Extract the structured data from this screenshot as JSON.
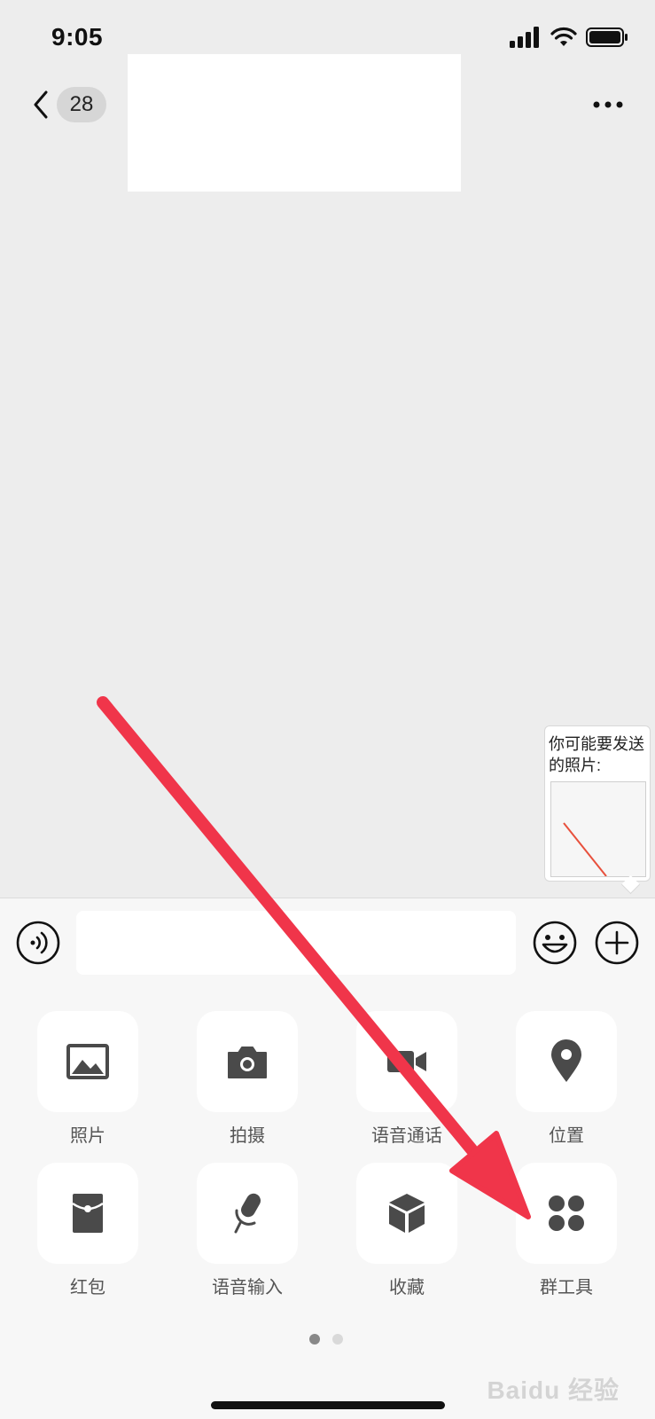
{
  "status_bar": {
    "time": "9:05"
  },
  "nav": {
    "unread_count": "28"
  },
  "suggestion": {
    "text": "你可能要发送的照片:"
  },
  "input": {
    "value": ""
  },
  "tools": [
    {
      "label": "照片",
      "icon": "image-icon"
    },
    {
      "label": "拍摄",
      "icon": "camera-icon"
    },
    {
      "label": "语音通话",
      "icon": "video-call-icon"
    },
    {
      "label": "位置",
      "icon": "location-icon"
    },
    {
      "label": "红包",
      "icon": "red-packet-icon"
    },
    {
      "label": "语音输入",
      "icon": "microphone-icon"
    },
    {
      "label": "收藏",
      "icon": "favorites-cube-icon"
    },
    {
      "label": "群工具",
      "icon": "group-tools-icon"
    }
  ],
  "pager": {
    "pages": 2,
    "current": 1
  },
  "annotation": {
    "arrow_color": "#f0354a"
  },
  "watermark": {
    "text": "Baidu 经验"
  },
  "colors": {
    "background": "#ededed",
    "panel": "#f7f7f7",
    "icon": "#4a4a4a"
  }
}
